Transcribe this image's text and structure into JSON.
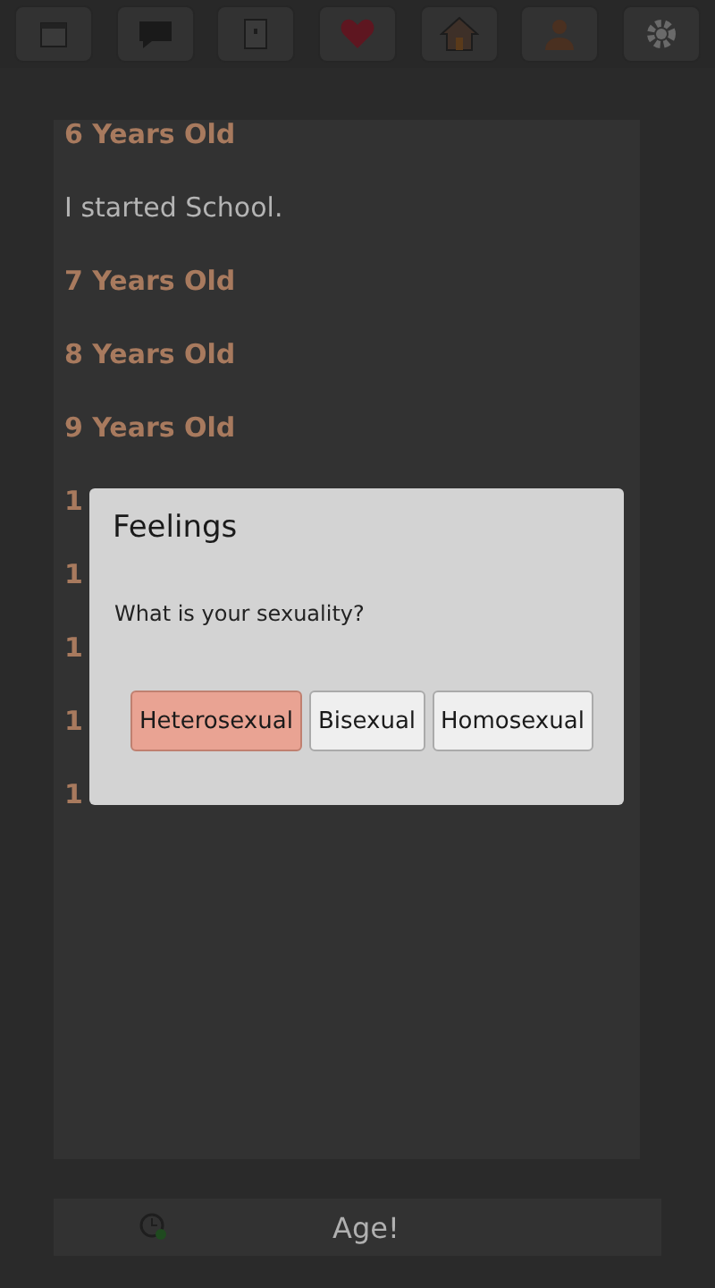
{
  "toolbar": {
    "buttons": [
      {
        "kind": "calendar"
      },
      {
        "kind": "chat"
      },
      {
        "kind": "document"
      },
      {
        "kind": "heart"
      },
      {
        "kind": "house"
      },
      {
        "kind": "person"
      },
      {
        "kind": "gear"
      }
    ]
  },
  "log": [
    {
      "kind": "heading",
      "text": "6 Years Old"
    },
    {
      "kind": "event",
      "text": "I started School."
    },
    {
      "kind": "heading",
      "text": "7 Years Old"
    },
    {
      "kind": "heading",
      "text": "8 Years Old"
    },
    {
      "kind": "heading",
      "text": "9 Years Old"
    },
    {
      "kind": "heading",
      "text": "1"
    },
    {
      "kind": "heading",
      "text": "1"
    },
    {
      "kind": "heading",
      "text": "1"
    },
    {
      "kind": "heading",
      "text": "1"
    },
    {
      "kind": "heading",
      "text": "1"
    }
  ],
  "dialog": {
    "title": "Feelings",
    "message": "What is your sexuality?",
    "options": [
      {
        "label": "Heterosexual",
        "selected": true
      },
      {
        "label": "Bisexual",
        "selected": false
      },
      {
        "label": "Homosexual",
        "selected": false
      }
    ]
  },
  "bottom_bar": {
    "button": "Age!"
  }
}
